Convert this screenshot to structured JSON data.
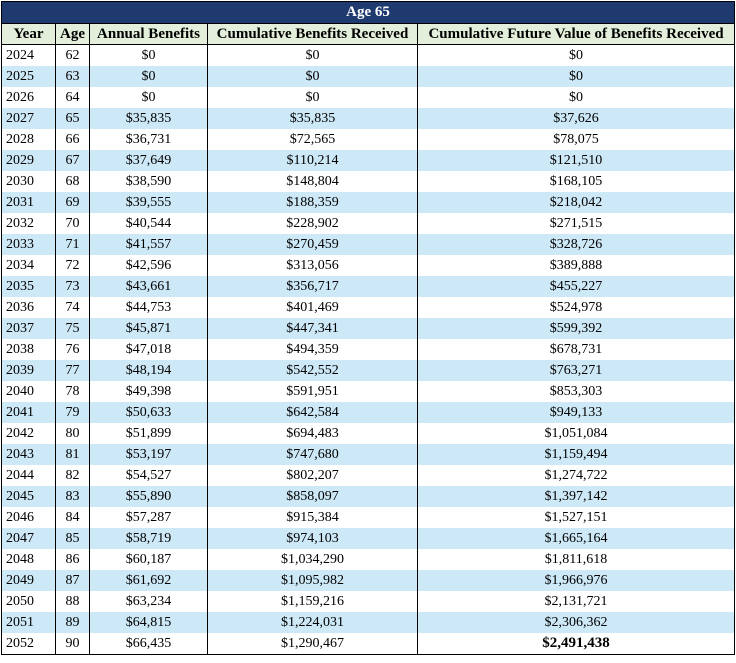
{
  "table": {
    "title": "Age 65",
    "headers": [
      "Year",
      "Age",
      "Annual Benefits",
      "Cumulative Benefits Received",
      "Cumulative Future Value of Benefits Received"
    ],
    "rows": [
      [
        "2024",
        "62",
        "$0",
        "$0",
        "$0"
      ],
      [
        "2025",
        "63",
        "$0",
        "$0",
        "$0"
      ],
      [
        "2026",
        "64",
        "$0",
        "$0",
        "$0"
      ],
      [
        "2027",
        "65",
        "$35,835",
        "$35,835",
        "$37,626"
      ],
      [
        "2028",
        "66",
        "$36,731",
        "$72,565",
        "$78,075"
      ],
      [
        "2029",
        "67",
        "$37,649",
        "$110,214",
        "$121,510"
      ],
      [
        "2030",
        "68",
        "$38,590",
        "$148,804",
        "$168,105"
      ],
      [
        "2031",
        "69",
        "$39,555",
        "$188,359",
        "$218,042"
      ],
      [
        "2032",
        "70",
        "$40,544",
        "$228,902",
        "$271,515"
      ],
      [
        "2033",
        "71",
        "$41,557",
        "$270,459",
        "$328,726"
      ],
      [
        "2034",
        "72",
        "$42,596",
        "$313,056",
        "$389,888"
      ],
      [
        "2035",
        "73",
        "$43,661",
        "$356,717",
        "$455,227"
      ],
      [
        "2036",
        "74",
        "$44,753",
        "$401,469",
        "$524,978"
      ],
      [
        "2037",
        "75",
        "$45,871",
        "$447,341",
        "$599,392"
      ],
      [
        "2038",
        "76",
        "$47,018",
        "$494,359",
        "$678,731"
      ],
      [
        "2039",
        "77",
        "$48,194",
        "$542,552",
        "$763,271"
      ],
      [
        "2040",
        "78",
        "$49,398",
        "$591,951",
        "$853,303"
      ],
      [
        "2041",
        "79",
        "$50,633",
        "$642,584",
        "$949,133"
      ],
      [
        "2042",
        "80",
        "$51,899",
        "$694,483",
        "$1,051,084"
      ],
      [
        "2043",
        "81",
        "$53,197",
        "$747,680",
        "$1,159,494"
      ],
      [
        "2044",
        "82",
        "$54,527",
        "$802,207",
        "$1,274,722"
      ],
      [
        "2045",
        "83",
        "$55,890",
        "$858,097",
        "$1,397,142"
      ],
      [
        "2046",
        "84",
        "$57,287",
        "$915,384",
        "$1,527,151"
      ],
      [
        "2047",
        "85",
        "$58,719",
        "$974,103",
        "$1,665,164"
      ],
      [
        "2048",
        "86",
        "$60,187",
        "$1,034,290",
        "$1,811,618"
      ],
      [
        "2049",
        "87",
        "$61,692",
        "$1,095,982",
        "$1,966,976"
      ],
      [
        "2050",
        "88",
        "$63,234",
        "$1,159,216",
        "$2,131,721"
      ],
      [
        "2051",
        "89",
        "$64,815",
        "$1,224,031",
        "$2,306,362"
      ],
      [
        "2052",
        "90",
        "$66,435",
        "$1,290,467",
        "$2,491,438"
      ]
    ],
    "colors": {
      "title_bg": "#1f3a6e",
      "header_bg": "#e3efda",
      "stripe_bg": "#cde8f6"
    }
  }
}
